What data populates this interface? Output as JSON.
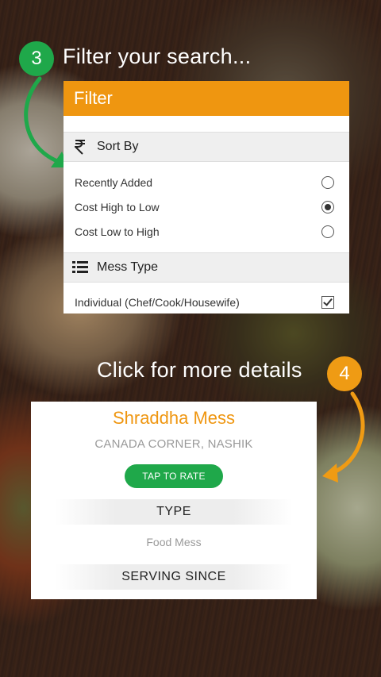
{
  "steps": {
    "step3": {
      "number": "3",
      "caption": "Filter your search...",
      "color": "#1fa84a"
    },
    "step4": {
      "number": "4",
      "caption": "Click for more details",
      "color": "#ef9b14"
    }
  },
  "filter": {
    "title": "Filter",
    "header_color": "#ef9610",
    "sort_by": {
      "label": "Sort By",
      "icon": "rupee-icon",
      "options": [
        {
          "label": "Recently Added",
          "selected": false
        },
        {
          "label": "Cost High to Low",
          "selected": true
        },
        {
          "label": "Cost Low to High",
          "selected": false
        }
      ]
    },
    "mess_type": {
      "label": "Mess Type",
      "icon": "list-icon",
      "options": [
        {
          "label": "Individual (Chef/Cook/Housewife)",
          "checked": true
        }
      ]
    }
  },
  "card": {
    "name": "Shraddha Mess",
    "location": "CANADA CORNER, NASHIK",
    "rate_button": "TAP TO RATE",
    "type_label": "TYPE",
    "type_value": "Food Mess",
    "serving_label": "SERVING SINCE"
  }
}
